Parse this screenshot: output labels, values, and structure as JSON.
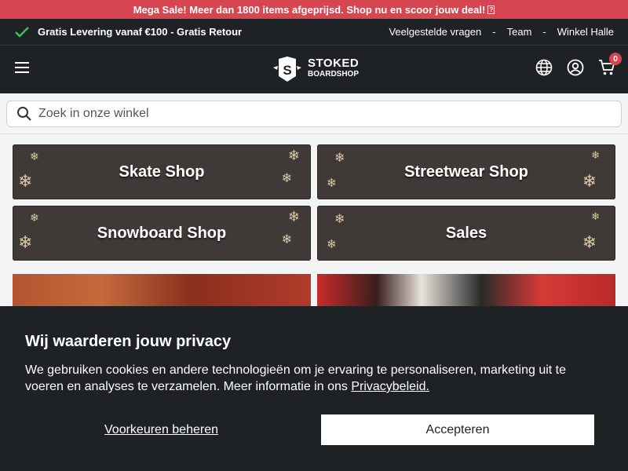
{
  "promo": {
    "text": "Mega Sale! Meer dan 1800 items afgeprijsd. Shop nu en scoor jouw deal!",
    "glyph": "?"
  },
  "usp": {
    "shipping": "Gratis Levering vanaf €100 - Gratis Retour",
    "links": [
      "Veelgestelde vragen",
      "Team",
      "Winkel Halle"
    ],
    "separator": "-"
  },
  "header": {
    "logo_line1": "STOKED",
    "logo_line2": "BOARDSHOP",
    "logo_mark": "S",
    "cart_count": "0",
    "icons": [
      "menu-icon",
      "globe-icon",
      "account-icon",
      "cart-icon"
    ]
  },
  "search": {
    "placeholder": "Zoek in onze winkel",
    "value": ""
  },
  "tiles": [
    {
      "label": "Skate Shop"
    },
    {
      "label": "Streetwear Shop"
    },
    {
      "label": "Snowboard Shop"
    },
    {
      "label": "Sales"
    }
  ],
  "privacy": {
    "title": "Wij waarderen jouw privacy",
    "body": "We gebruiken cookies en andere technologieën om je ervaring te personaliseren, marketing uit te voeren en analyses te verzamelen. Meer informatie in ons ",
    "link": "Privacybeleid.",
    "preferences": "Voorkeuren beheren",
    "accept": "Accepteren"
  },
  "colors": {
    "promo": "#d64550",
    "dark": "#1f2224",
    "tile": "#3f3a38",
    "flake": "#d9c7a8"
  }
}
